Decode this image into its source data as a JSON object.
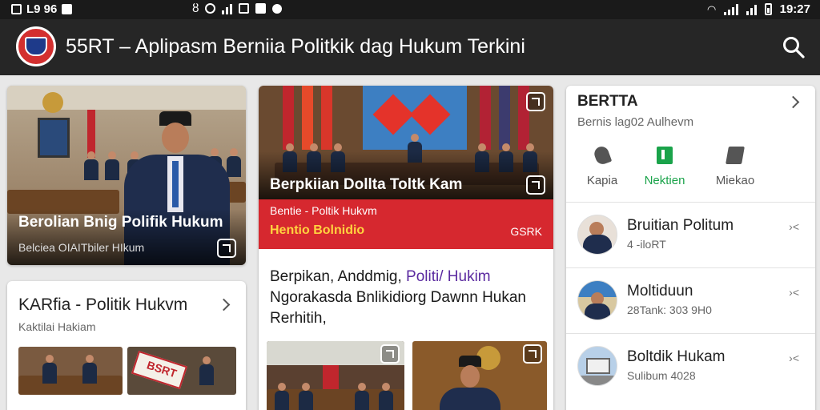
{
  "status_bar": {
    "left_text": "L9 96",
    "time": "19:27"
  },
  "app_bar": {
    "title": "55RT – Aplipasm Berniia Politkik dag Hukum Terkini"
  },
  "feature_left": {
    "caption": "Berolian Bnig Polifik Hukum",
    "source": "Belciea OIAITbiler HIkum"
  },
  "feature_center": {
    "overlay_title": "Berpkiian  Dollta Toltk Kam",
    "band_sub": "Bentie - Poltik Hukvm",
    "band_tag": "Hentio Bolnidio",
    "band_tag_right": "GSRK",
    "headline_line1": "Berpikan, Anddmig,",
    "headline_link": "Politi/ Hukim",
    "headline_line2": "Ngorakasda Bnlikidiorg Dawnn Hukan",
    "headline_line3": "Rerhitih,"
  },
  "lower_left": {
    "title": "KARfia - Politik Hukvm",
    "subtitle": "Kaktilai Hakiam",
    "thumb_sign": "BSRT"
  },
  "side_panel": {
    "title": "BERTTA",
    "subtitle": "Bernis lag02 Aulhevm",
    "tabs": [
      {
        "label": "Kapia",
        "icon": "tag-icon",
        "active": false
      },
      {
        "label": "Nektien",
        "icon": "flag-icon",
        "active": true
      },
      {
        "label": "Miekao",
        "icon": "bookmark-icon",
        "active": false
      }
    ],
    "accent_color": "#1aa34a",
    "items": [
      {
        "title": "Bruitian Politum",
        "sub": "4 -iloRT",
        "share": "›<"
      },
      {
        "title": "Moltiduun",
        "sub": "28Tank: 303 9H0",
        "share": "›<"
      },
      {
        "title": "Boltdik Hukam",
        "sub": "Sulibum 4028",
        "share": "›<"
      }
    ]
  }
}
